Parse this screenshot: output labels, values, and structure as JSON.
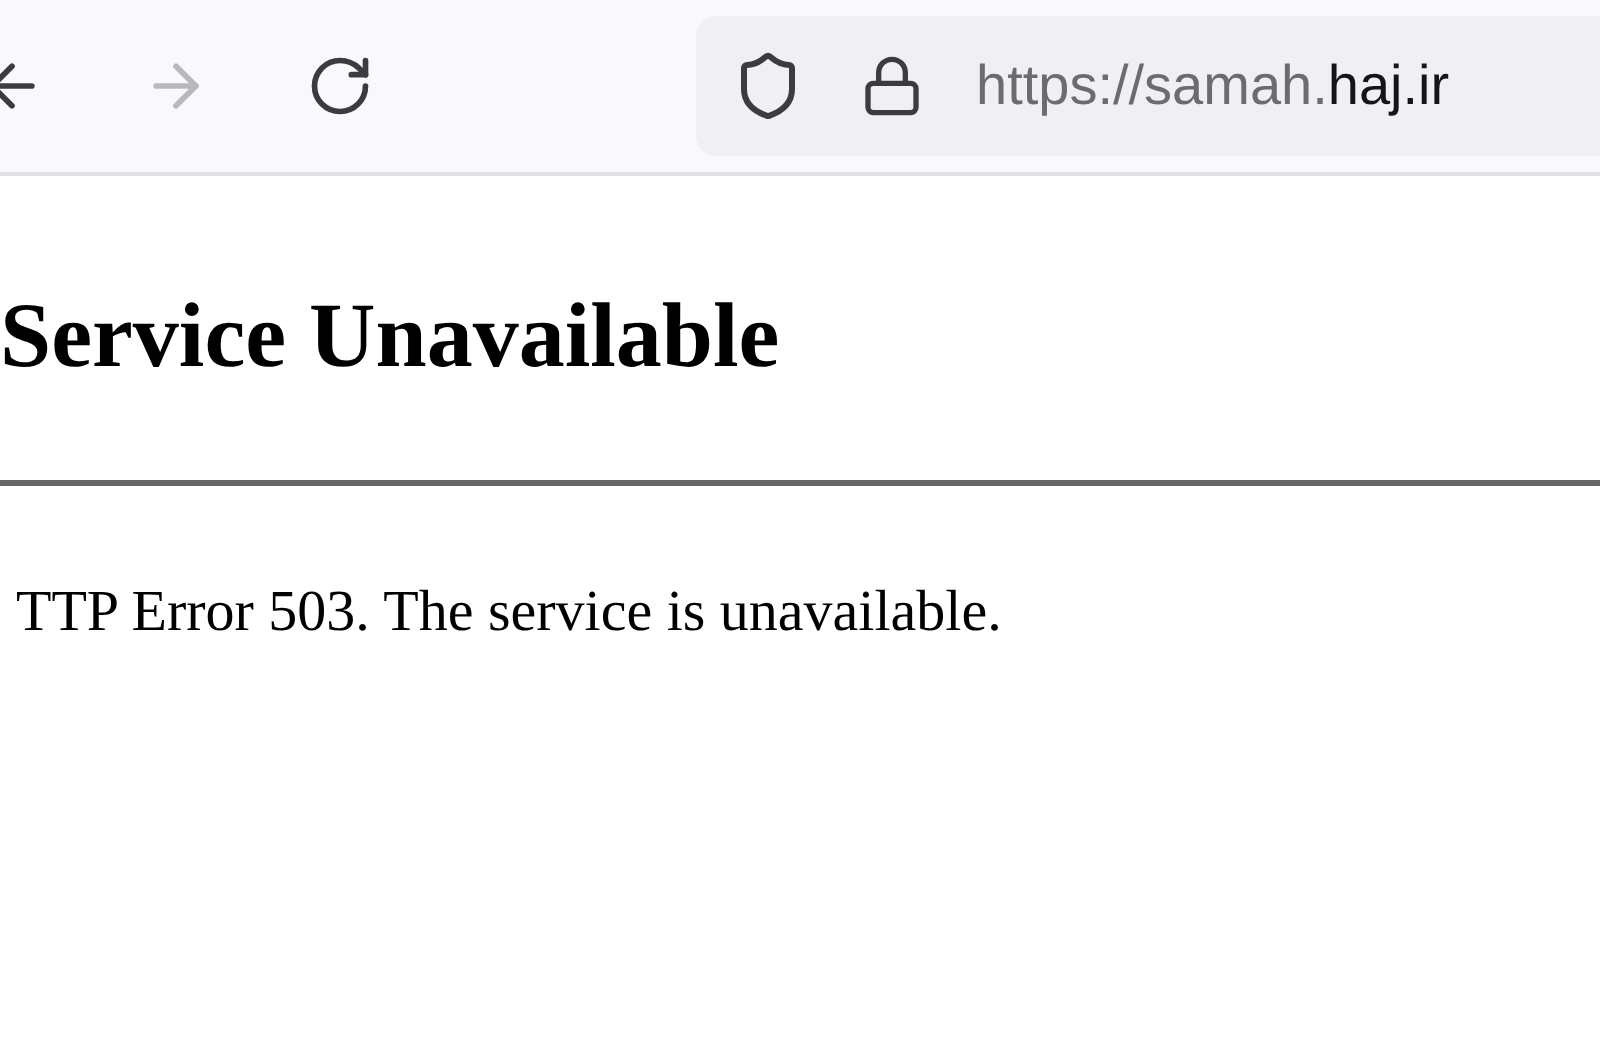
{
  "toolbar": {
    "buttons": [
      {
        "kind": "back",
        "disabled": false
      },
      {
        "kind": "forward",
        "disabled": true
      },
      {
        "kind": "reload",
        "disabled": false
      }
    ],
    "address_bar": {
      "url_prefix": "https://samah.",
      "url_host": "haj.ir"
    }
  },
  "page": {
    "heading": "Service Unavailable",
    "message": "TTP Error 503. The service is unavailable."
  }
}
